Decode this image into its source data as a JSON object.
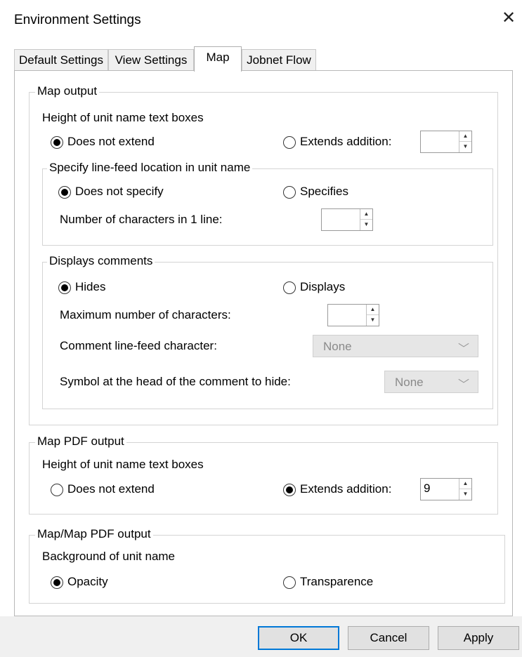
{
  "window": {
    "title": "Environment Settings",
    "close_glyph": "✕"
  },
  "tabs": [
    {
      "label": "Default Settings"
    },
    {
      "label": "View Settings"
    },
    {
      "label": "Map"
    },
    {
      "label": "Jobnet Flow"
    }
  ],
  "map_output": {
    "legend": "Map output",
    "height_label": "Height of unit name text boxes",
    "radio_not_extend": "Does not extend",
    "radio_extends": "Extends addition:",
    "spin_value": "",
    "linefeed": {
      "legend": "Specify line-feed location in unit name",
      "radio_not_specify": "Does not specify",
      "radio_specifies": "Specifies",
      "chars_label": "Number of characters in 1 line:",
      "spin_value": ""
    },
    "comments": {
      "legend": "Displays comments",
      "radio_hides": "Hides",
      "radio_displays": "Displays",
      "max_label": "Maximum number of characters:",
      "spin_value": "",
      "linefeed_char_label": "Comment line-feed character:",
      "linefeed_char_value": "None",
      "symbol_label": "Symbol at the head of the comment to hide:",
      "symbol_value": "None"
    }
  },
  "map_pdf_output": {
    "legend": "Map PDF output",
    "height_label": "Height of unit name text boxes",
    "radio_not_extend": "Does not extend",
    "radio_extends": "Extends addition:",
    "spin_value": "9"
  },
  "map_map_pdf_output": {
    "legend": "Map/Map PDF output",
    "background_label": "Background of unit name",
    "radio_opacity": "Opacity",
    "radio_transparence": "Transparence"
  },
  "buttons": {
    "ok": "OK",
    "cancel": "Cancel",
    "apply": "Apply"
  }
}
